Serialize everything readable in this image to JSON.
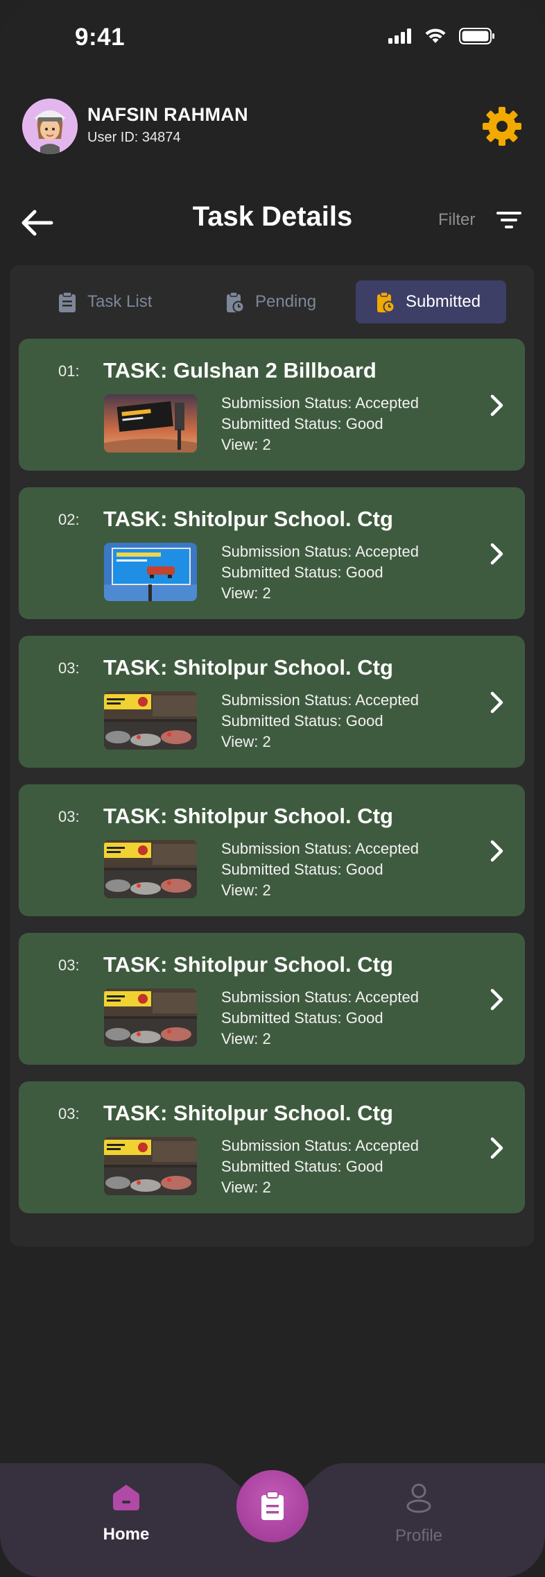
{
  "status_bar": {
    "time": "9:41"
  },
  "user": {
    "name": "NAFSIN RAHMAN",
    "id_label": "User ID: 34874"
  },
  "header": {
    "title": "Task Details",
    "filter_label": "Filter"
  },
  "tabs": [
    {
      "label": "Task List",
      "active": false
    },
    {
      "label": "Pending",
      "active": false
    },
    {
      "label": "Submitted",
      "active": true
    }
  ],
  "tasks": [
    {
      "num": "01:",
      "title": "TASK: Gulshan 2 Billboard",
      "submission_status": "Submission Status: Accepted",
      "submitted_status": "Submitted Status: Good",
      "view": "View: 2"
    },
    {
      "num": "02:",
      "title": "TASK: Shitolpur School. Ctg",
      "submission_status": "Submission Status: Accepted",
      "submitted_status": "Submitted Status: Good",
      "view": "View: 2"
    },
    {
      "num": "03:",
      "title": "TASK: Shitolpur School. Ctg",
      "submission_status": "Submission Status: Accepted",
      "submitted_status": "Submitted Status: Good",
      "view": "View: 2"
    },
    {
      "num": "03:",
      "title": "TASK: Shitolpur School. Ctg",
      "submission_status": "Submission Status: Accepted",
      "submitted_status": "Submitted Status: Good",
      "view": "View: 2"
    },
    {
      "num": "03:",
      "title": "TASK: Shitolpur School. Ctg",
      "submission_status": "Submission Status: Accepted",
      "submitted_status": "Submitted Status: Good",
      "view": "View: 2"
    },
    {
      "num": "03:",
      "title": "TASK: Shitolpur School. Ctg",
      "submission_status": "Submission Status: Accepted",
      "submitted_status": "Submitted Status: Good",
      "view": "View: 2"
    }
  ],
  "nav": {
    "home_label": "Home",
    "profile_label": "Profile"
  },
  "colors": {
    "card": "#3f5b3f",
    "active_tab": "#3d3f67",
    "accent": "#f2a900",
    "fab": "#b14aa6",
    "nav_bg": "#37303f"
  },
  "icons": {
    "settings": "gear-icon",
    "back": "arrow-left-icon",
    "filter": "filter-icon",
    "task_list": "clipboard-icon",
    "pending": "clipboard-clock-icon",
    "submitted": "clipboard-clock-icon",
    "chevron": "chevron-right-icon",
    "home": "home-icon",
    "profile": "user-icon",
    "fab": "clipboard-icon"
  }
}
